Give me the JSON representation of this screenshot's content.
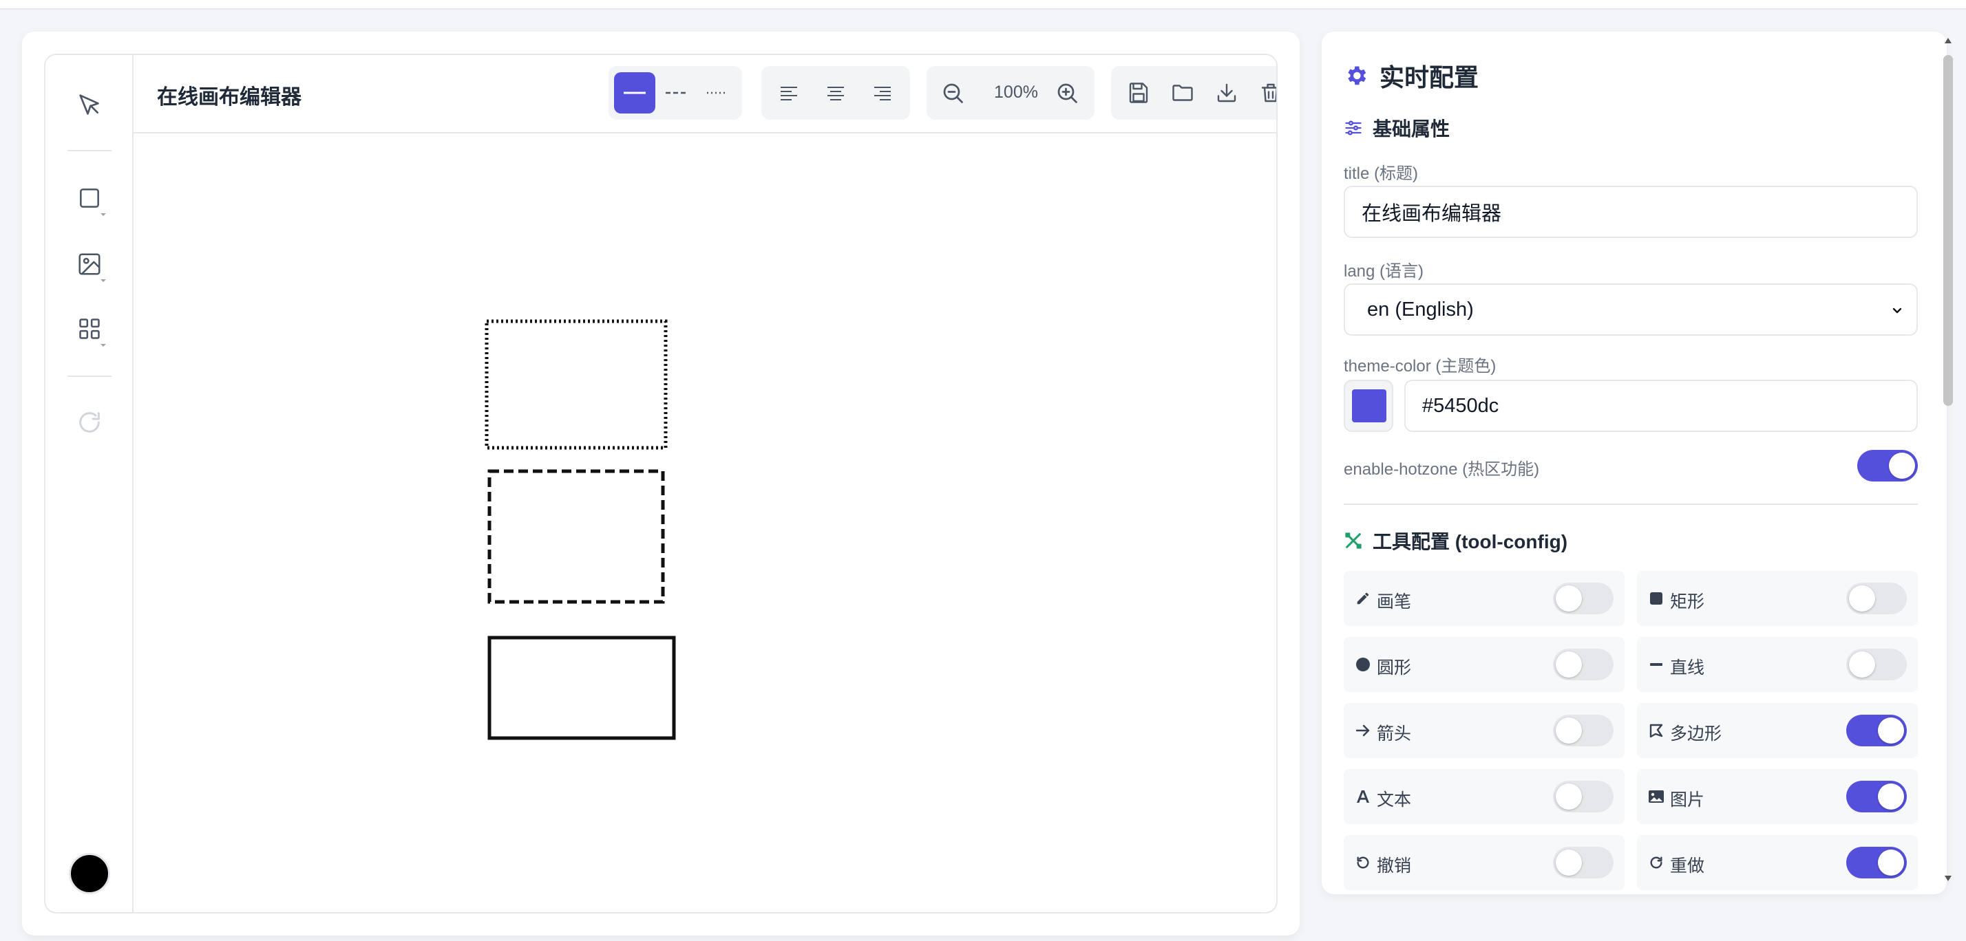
{
  "editor": {
    "title": "在线画布编辑器",
    "zoom": "100%",
    "line_styles": [
      "solid",
      "dashed",
      "dotted"
    ],
    "active_line_style": "solid",
    "current_color": "#000000"
  },
  "config": {
    "panel_title": "实时配置",
    "basic_section_title": "基础属性",
    "title_label": "title (标题)",
    "title_value": "在线画布编辑器",
    "lang_label": "lang (语言)",
    "lang_value": "en (English)",
    "theme_label": "theme-color (主题色)",
    "theme_value": "#5450dc",
    "hotzone_label": "enable-hotzone (热区功能)",
    "hotzone_enabled": true,
    "tool_section_title": "工具配置 (tool-config)",
    "tools": [
      {
        "label": "画笔",
        "icon": "pencil-icon",
        "enabled": false
      },
      {
        "label": "矩形",
        "icon": "square-icon",
        "enabled": false
      },
      {
        "label": "圆形",
        "icon": "circle-icon",
        "enabled": false
      },
      {
        "label": "直线",
        "icon": "line-icon",
        "enabled": false
      },
      {
        "label": "箭头",
        "icon": "arrow-icon",
        "enabled": false
      },
      {
        "label": "多边形",
        "icon": "polygon-icon",
        "enabled": true
      },
      {
        "label": "文本",
        "icon": "text-icon",
        "enabled": false
      },
      {
        "label": "图片",
        "icon": "image-icon",
        "enabled": true
      },
      {
        "label": "撤销",
        "icon": "undo-icon",
        "enabled": false
      },
      {
        "label": "重做",
        "icon": "redo-icon",
        "enabled": true
      }
    ]
  },
  "colors": {
    "accent": "#5450dc",
    "tool_green": "#22a06b"
  }
}
